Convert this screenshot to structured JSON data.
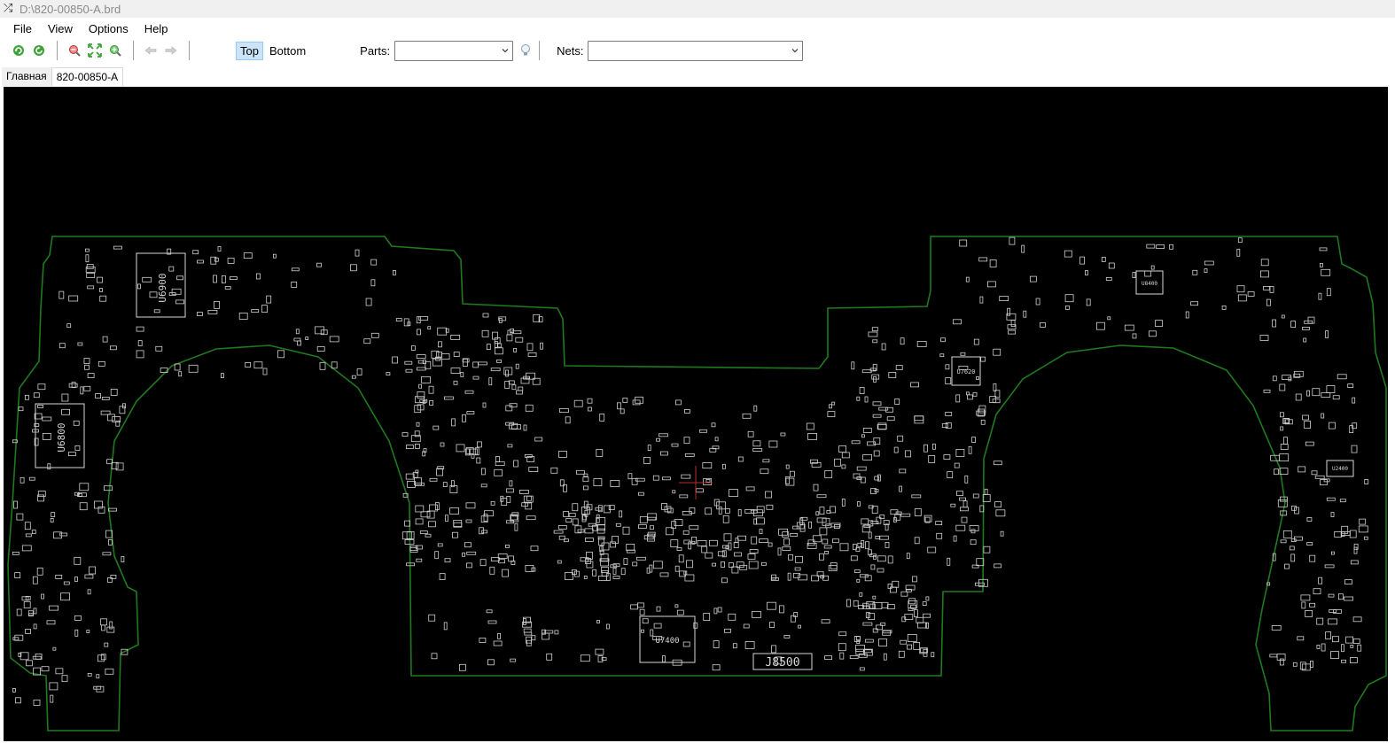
{
  "window": {
    "title": "D:\\820-00850-A.brd",
    "icon": "shuffle-icon"
  },
  "menu": [
    "File",
    "View",
    "Options",
    "Help"
  ],
  "toolbar": {
    "icons": [
      "reload-icon",
      "rotate-icon",
      "zoom-out-icon",
      "zoom-fit-icon",
      "zoom-in-icon",
      "back-arrow-icon",
      "forward-arrow-icon"
    ],
    "side_top": "Top",
    "side_bottom": "Bottom",
    "parts_label": "Parts:",
    "parts_value": "",
    "nets_label": "Nets:",
    "nets_value": "",
    "highlight_icon": "lightbulb-icon"
  },
  "tabs": [
    "Главная",
    "820-00850-A"
  ],
  "active_tab": "820-00850-A",
  "board": {
    "labels": [
      "U6900",
      "U6800",
      "U7400",
      "J8500",
      "U7620",
      "U8400",
      "U2400"
    ],
    "outline_color": "#1f7a1f",
    "part_color": "#d8d8d8",
    "background": "#000000"
  }
}
